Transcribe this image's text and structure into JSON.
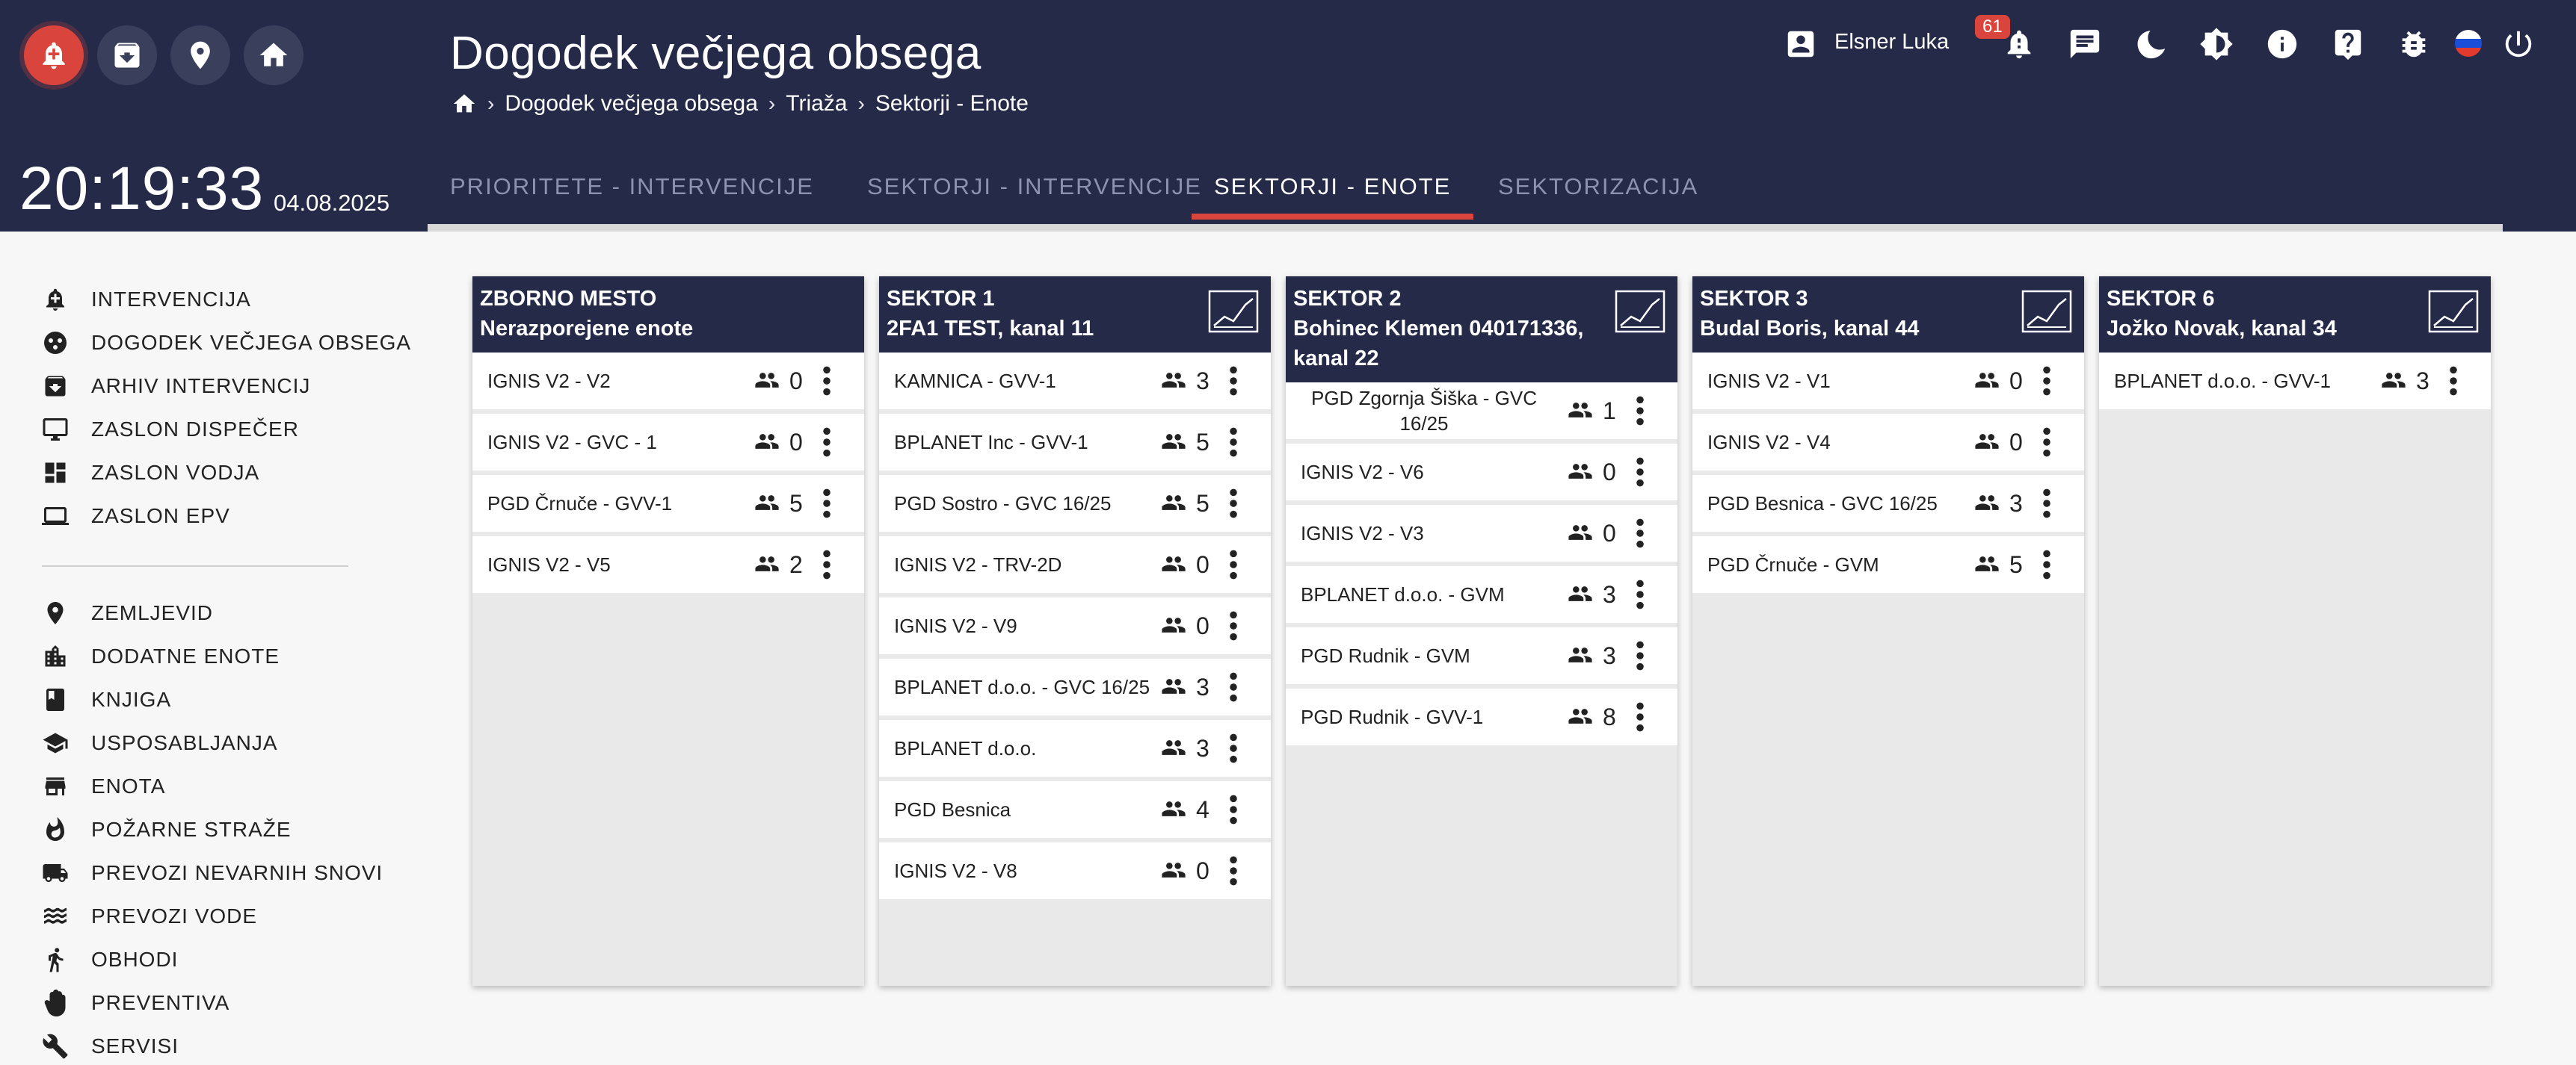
{
  "header": {
    "title": "Dogodek večjega obsega",
    "breadcrumb": [
      "Dogodek večjega obsega",
      "Triaža",
      "Sektorji - Enote"
    ],
    "clock": "20:19:33",
    "date": "04.08.2025",
    "user": "Elsner Luka",
    "notification_count": "61",
    "tabs": [
      "PRIORITETE - INTERVENCIJE",
      "SEKTORJI - INTERVENCIJE",
      "SEKTORJI - ENOTE",
      "SEKTORIZACIJA"
    ],
    "active_tab": "SEKTORJI - ENOTE",
    "accent_color": "#d9453d",
    "header_color": "#252a48"
  },
  "sidebar": {
    "group1": [
      "INTERVENCIJA",
      "DOGODEK VEČJEGA OBSEGA",
      "ARHIV INTERVENCIJ",
      "ZASLON DISPEČER",
      "ZASLON VODJA",
      "ZASLON EPV"
    ],
    "group2": [
      "ZEMLJEVID",
      "DODATNE ENOTE",
      "KNJIGA",
      "USPOSABLJANJA",
      "ENOTA",
      "POŽARNE STRAŽE",
      "PREVOZI NEVARNIH SNOVI",
      "PREVOZI VODE",
      "OBHODI",
      "PREVENTIVA",
      "SERVISI"
    ]
  },
  "columns": [
    {
      "title": "ZBORNO MESTO",
      "subtitle": "Nerazporejene enote",
      "units": [
        {
          "name": "IGNIS V2 - V2",
          "count": "0"
        },
        {
          "name": "IGNIS V2 - GVC - 1",
          "count": "0"
        },
        {
          "name": "PGD Črnuče - GVV-1",
          "count": "5"
        },
        {
          "name": "IGNIS V2 - V5",
          "count": "2"
        }
      ]
    },
    {
      "title": "SEKTOR 1",
      "subtitle": "2FA1 TEST, kanal 11",
      "units": [
        {
          "name": "KAMNICA - GVV-1",
          "count": "3"
        },
        {
          "name": "BPLANET Inc - GVV-1",
          "count": "5"
        },
        {
          "name": "PGD Sostro - GVC 16/25",
          "count": "5"
        },
        {
          "name": "IGNIS V2 - TRV-2D",
          "count": "0"
        },
        {
          "name": "IGNIS V2 - V9",
          "count": "0"
        },
        {
          "name": "BPLANET d.o.o. - GVC 16/25",
          "count": "3"
        },
        {
          "name": "BPLANET d.o.o.",
          "count": "3"
        },
        {
          "name": "PGD Besnica",
          "count": "4"
        },
        {
          "name": "IGNIS V2 - V8",
          "count": "0"
        }
      ]
    },
    {
      "title": "SEKTOR 2",
      "subtitle": "Bohinec Klemen 040171336, kanal 22",
      "units": [
        {
          "name": "PGD Zgornja Šiška - GVC 16/25",
          "count": "1"
        },
        {
          "name": "IGNIS V2 - V6",
          "count": "0"
        },
        {
          "name": "IGNIS V2 - V3",
          "count": "0"
        },
        {
          "name": "BPLANET d.o.o. - GVM",
          "count": "3"
        },
        {
          "name": "PGD Rudnik - GVM",
          "count": "3"
        },
        {
          "name": "PGD Rudnik - GVV-1",
          "count": "8"
        }
      ]
    },
    {
      "title": "SEKTOR 3",
      "subtitle": "Budal Boris, kanal 44",
      "units": [
        {
          "name": "IGNIS V2 - V1",
          "count": "0"
        },
        {
          "name": "IGNIS V2 - V4",
          "count": "0"
        },
        {
          "name": "PGD Besnica - GVC 16/25",
          "count": "3"
        },
        {
          "name": "PGD Črnuče - GVM",
          "count": "5"
        }
      ]
    },
    {
      "title": "SEKTOR 6",
      "subtitle": "Jožko Novak, kanal 34",
      "units": [
        {
          "name": "BPLANET d.o.o. - GVV-1",
          "count": "3"
        }
      ]
    }
  ]
}
